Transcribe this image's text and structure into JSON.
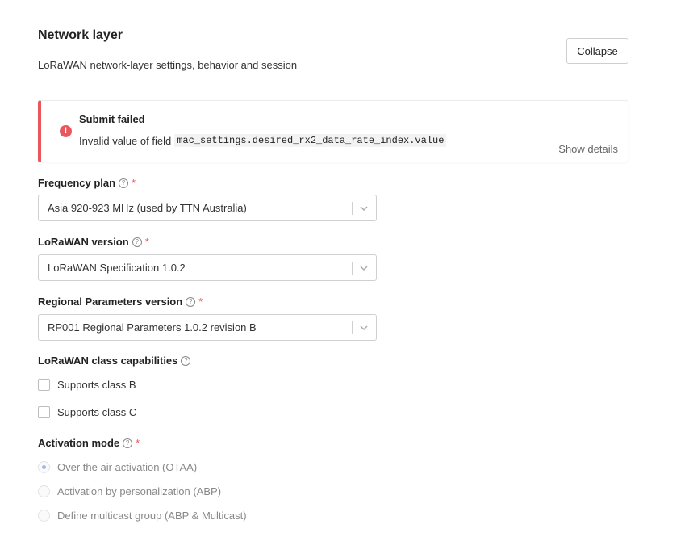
{
  "section": {
    "title": "Network layer",
    "description": "LoRaWAN network-layer settings, behavior and session",
    "collapse_label": "Collapse"
  },
  "alert": {
    "title": "Submit failed",
    "message_prefix": "Invalid value of field",
    "field_code": "mac_settings.desired_rx2_data_rate_index.value",
    "details_label": "Show details",
    "icon": "alert-circle-icon",
    "color": "#e8575b"
  },
  "fields": {
    "frequency_plan": {
      "label": "Frequency plan",
      "required": "*",
      "value": "Asia 920-923 MHz (used by TTN Australia)"
    },
    "lorawan_version": {
      "label": "LoRaWAN version",
      "required": "*",
      "value": "LoRaWAN Specification 1.0.2"
    },
    "regional_parameters": {
      "label": "Regional Parameters version",
      "required": "*",
      "value": "RP001 Regional Parameters 1.0.2 revision B"
    },
    "class_capabilities": {
      "label": "LoRaWAN class capabilities",
      "options": [
        {
          "label": "Supports class B",
          "checked": false
        },
        {
          "label": "Supports class C",
          "checked": false
        }
      ]
    },
    "activation_mode": {
      "label": "Activation mode",
      "required": "*",
      "options": [
        {
          "label": "Over the air activation (OTAA)",
          "checked": true
        },
        {
          "label": "Activation by personalization (ABP)",
          "checked": false
        },
        {
          "label": "Define multicast group (ABP & Multicast)",
          "checked": false
        }
      ]
    }
  },
  "help_glyph": "?",
  "alert_glyph": "!"
}
